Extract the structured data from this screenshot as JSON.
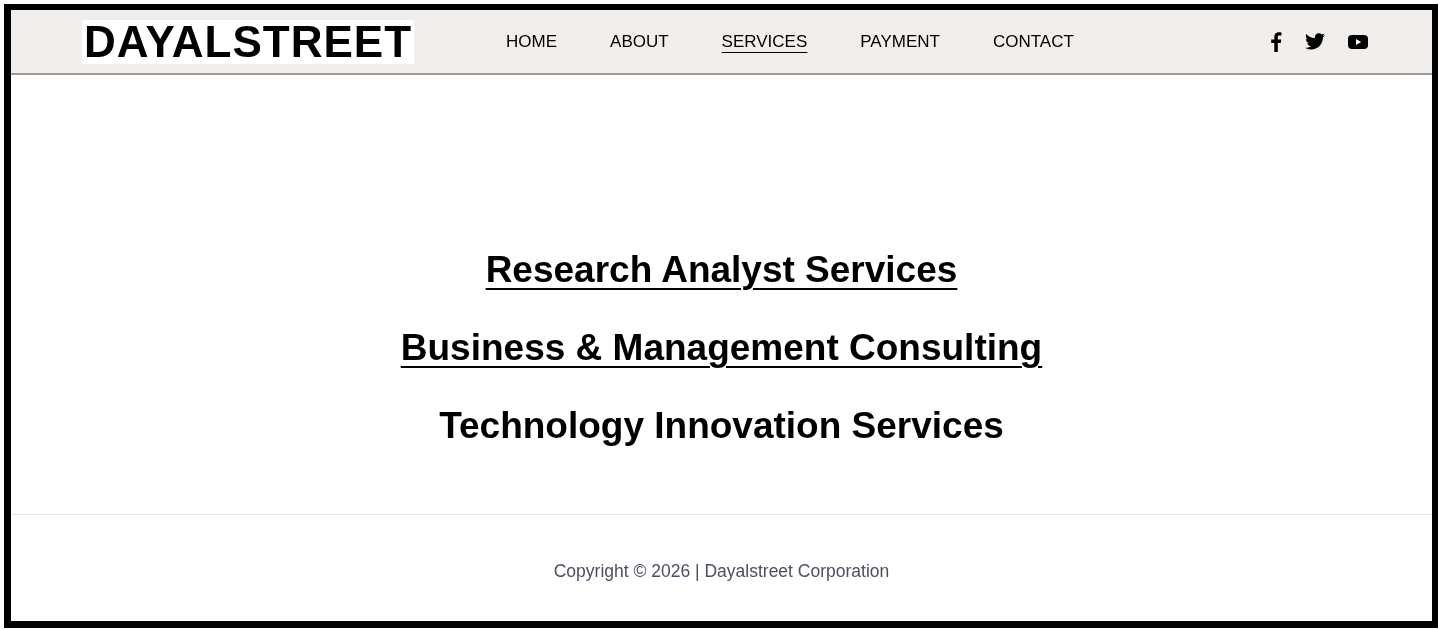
{
  "header": {
    "logo": "DAYALSTREET",
    "nav": [
      {
        "label": "HOME",
        "selected": false
      },
      {
        "label": "ABOUT",
        "selected": false
      },
      {
        "label": "SERVICES",
        "selected": true
      },
      {
        "label": "PAYMENT",
        "selected": false
      },
      {
        "label": "CONTACT",
        "selected": false
      }
    ],
    "social": [
      {
        "kind": "facebook"
      },
      {
        "kind": "twitter"
      },
      {
        "kind": "youtube"
      }
    ]
  },
  "services": [
    {
      "title": "Research Analyst Services",
      "underlined": true
    },
    {
      "title": "Business & Management Consulting",
      "underlined": true
    },
    {
      "title": "Technology Innovation Services",
      "underlined": false
    }
  ],
  "footer": {
    "copyright": "Copyright © 2026 | Dayalstreet Corporation"
  }
}
